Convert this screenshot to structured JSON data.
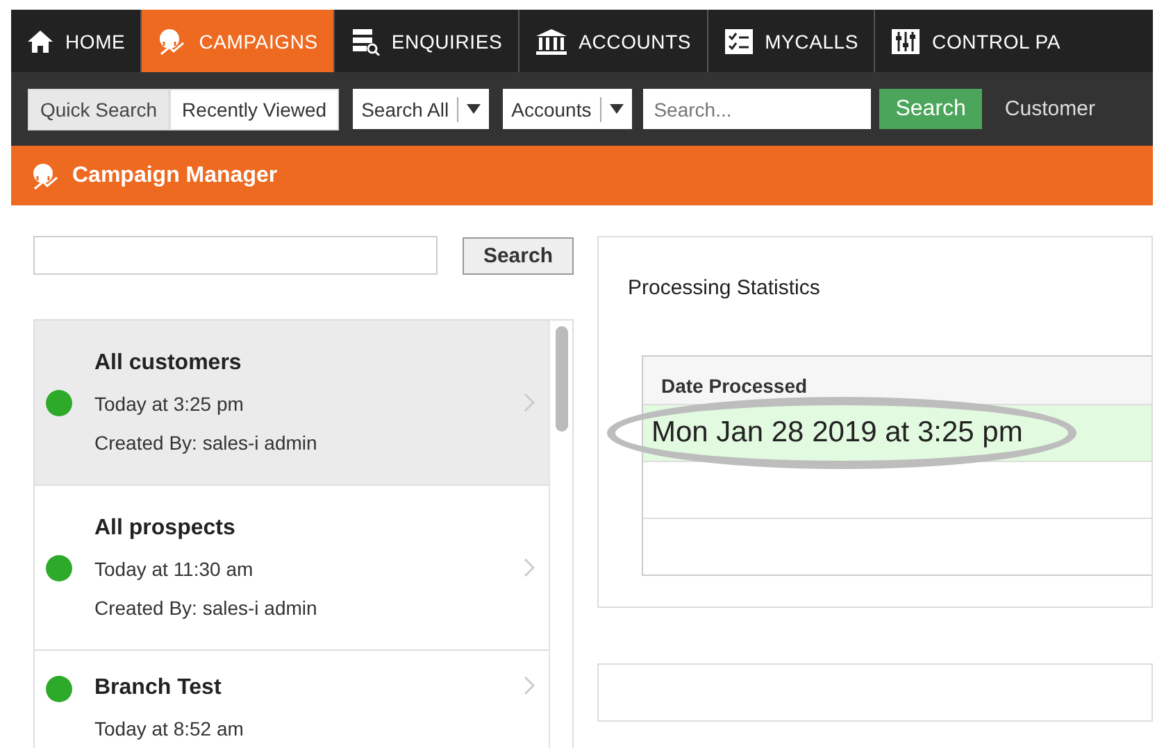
{
  "nav_tabs": [
    {
      "label": "HOME",
      "selected": false
    },
    {
      "label": "CAMPAIGNS",
      "selected": true
    },
    {
      "label": "ENQUIRIES",
      "selected": false
    },
    {
      "label": "ACCOUNTS",
      "selected": false
    },
    {
      "label": "MYCALLS",
      "selected": false
    },
    {
      "label": "CONTROL PA",
      "selected": false
    }
  ],
  "search_bar": {
    "modes": [
      {
        "label": "Quick Search",
        "selected": true
      },
      {
        "label": "Recently Viewed",
        "selected": false
      }
    ],
    "dropdowns": [
      {
        "value": "Search All"
      },
      {
        "value": "Accounts"
      }
    ],
    "placeholder": "Search...",
    "button": "Search",
    "trailing": "Customer"
  },
  "page_title": "Campaign Manager",
  "campaign_search": {
    "button": "Search"
  },
  "campaigns": [
    {
      "name": "All customers",
      "time": "Today at 3:25 pm",
      "created_by": "Created By: sales-i admin",
      "color": "#2eaa2a",
      "selected": true
    },
    {
      "name": "All prospects",
      "time": "Today at 11:30 am",
      "created_by": "Created By: sales-i admin",
      "color": "#2eaa2a",
      "selected": false
    },
    {
      "name": "Branch Test",
      "time": "Today at 8:52 am",
      "color": "#2eaa2a",
      "selected": false
    }
  ],
  "statistics": {
    "title": "Processing Statistics",
    "column": "Date Processed",
    "rows": [
      {
        "value": "Mon Jan 28 2019 at 3:25 pm",
        "highlighted": true
      },
      {
        "highlighted": false
      },
      {
        "highlighted": false
      }
    ]
  }
}
